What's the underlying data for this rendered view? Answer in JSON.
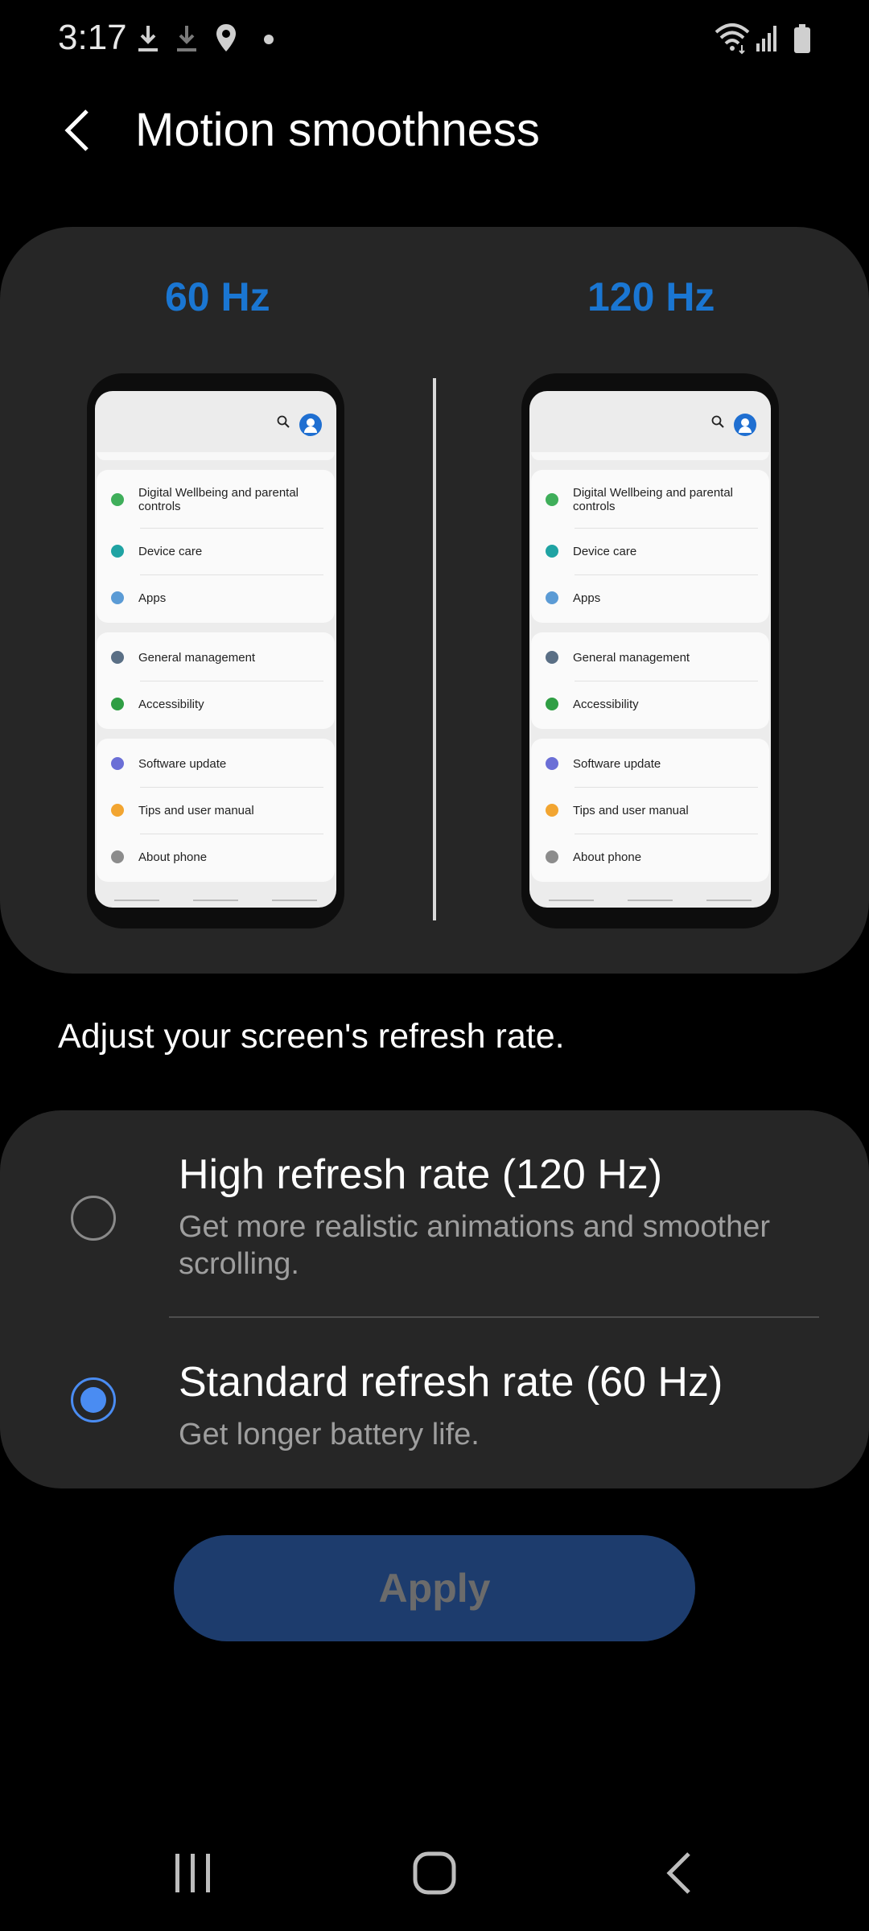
{
  "status_bar": {
    "time": "3:17",
    "left_icons": [
      "download-icon",
      "download-icon",
      "location-icon",
      "dot-icon"
    ],
    "right_icons": [
      "wifi-icon",
      "signal-icon",
      "battery-icon"
    ]
  },
  "header": {
    "back_icon": "chevron-left-icon",
    "title": "Motion smoothness"
  },
  "preview": {
    "left_label": "60 Hz",
    "right_label": "120 Hz",
    "phone_items": [
      {
        "label": "Digital Wellbeing and parental controls",
        "icon": "wellbeing-icon",
        "color": "#3fae5a"
      },
      {
        "label": "Device care",
        "icon": "device-care-icon",
        "color": "#1fa3a3"
      },
      {
        "label": "Apps",
        "icon": "apps-icon",
        "color": "#5b9bd5"
      },
      {
        "label": "General management",
        "icon": "sliders-icon",
        "color": "#5a6f85"
      },
      {
        "label": "Accessibility",
        "icon": "accessibility-icon",
        "color": "#2f9e44"
      },
      {
        "label": "Software update",
        "icon": "software-update-icon",
        "color": "#6b6fd6"
      },
      {
        "label": "Tips and user manual",
        "icon": "bulb-icon",
        "color": "#f2a531"
      },
      {
        "label": "About phone",
        "icon": "info-icon",
        "color": "#8c8c8c"
      }
    ]
  },
  "description": "Adjust your screen's refresh rate.",
  "options": [
    {
      "title": "High refresh rate (120 Hz)",
      "subtitle": "Get more realistic animations and smoother scrolling.",
      "selected": false
    },
    {
      "title": "Standard refresh rate (60 Hz)",
      "subtitle": "Get longer battery life.",
      "selected": true
    }
  ],
  "apply_label": "Apply",
  "nav_bar": {
    "icons": [
      "recents-icon",
      "home-icon",
      "back-nav-icon"
    ]
  },
  "colors": {
    "accent": "#1a76d2",
    "radio_selected": "#4a8cf2",
    "card_bg": "#262626",
    "apply_bg": "#1d3c6d"
  }
}
